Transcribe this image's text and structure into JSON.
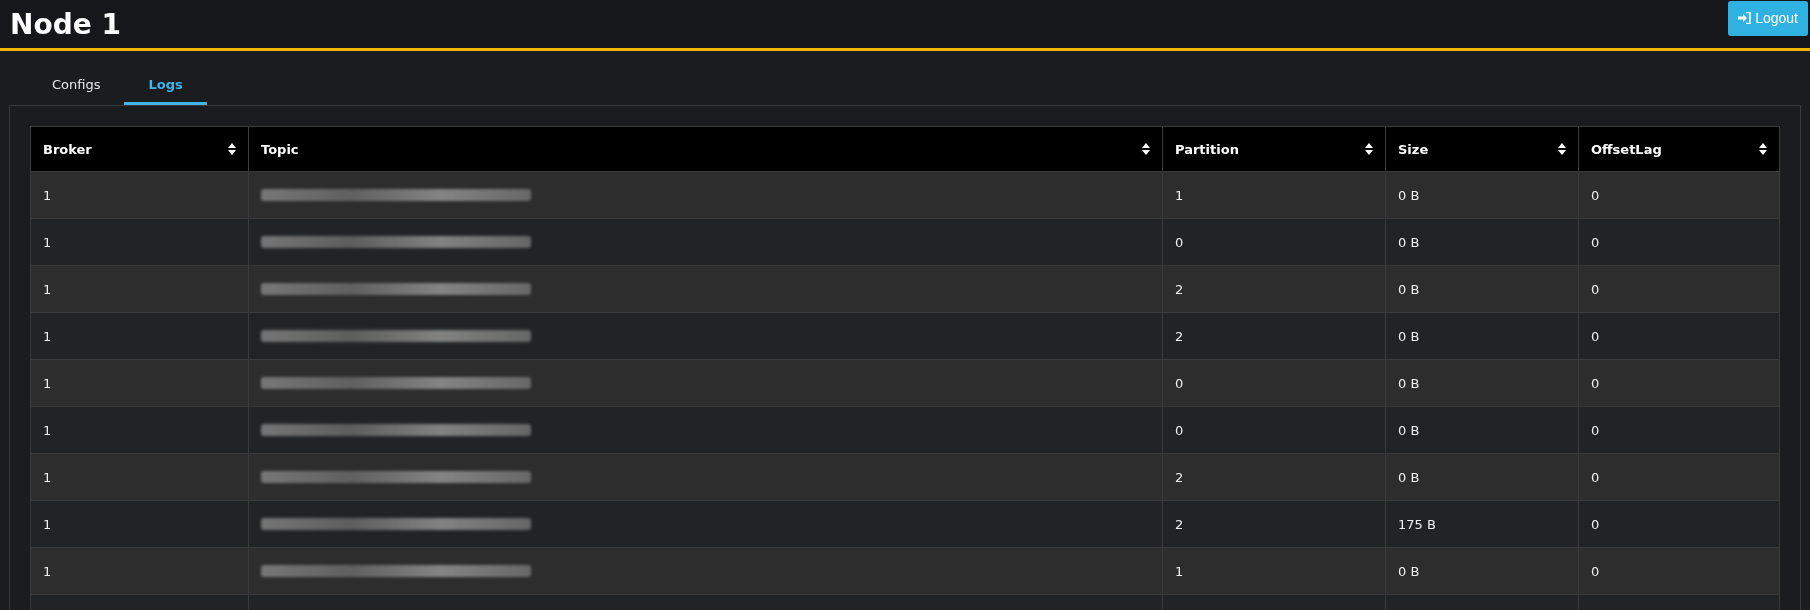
{
  "header": {
    "title": "Node 1",
    "logout": "Logout"
  },
  "tabs": [
    {
      "label": "Configs",
      "selected": false
    },
    {
      "label": "Logs",
      "selected": true
    }
  ],
  "table": {
    "columns": [
      "Broker",
      "Topic",
      "Partition",
      "Size",
      "OffsetLag"
    ],
    "rows": [
      {
        "broker": "1",
        "topic": {
          "kind": "redacted"
        },
        "partition": "1",
        "size": "0 B",
        "offset_lag": "0"
      },
      {
        "broker": "1",
        "topic": {
          "kind": "redacted"
        },
        "partition": "0",
        "size": "0 B",
        "offset_lag": "0"
      },
      {
        "broker": "1",
        "topic": {
          "kind": "redacted"
        },
        "partition": "2",
        "size": "0 B",
        "offset_lag": "0"
      },
      {
        "broker": "1",
        "topic": {
          "kind": "redacted"
        },
        "partition": "2",
        "size": "0 B",
        "offset_lag": "0"
      },
      {
        "broker": "1",
        "topic": {
          "kind": "redacted"
        },
        "partition": "0",
        "size": "0 B",
        "offset_lag": "0"
      },
      {
        "broker": "1",
        "topic": {
          "kind": "redacted"
        },
        "partition": "0",
        "size": "0 B",
        "offset_lag": "0"
      },
      {
        "broker": "1",
        "topic": {
          "kind": "redacted"
        },
        "partition": "2",
        "size": "0 B",
        "offset_lag": "0"
      },
      {
        "broker": "1",
        "topic": {
          "kind": "redacted"
        },
        "partition": "2",
        "size": "175 B",
        "offset_lag": "0"
      },
      {
        "broker": "1",
        "topic": {
          "kind": "redacted"
        },
        "partition": "1",
        "size": "0 B",
        "offset_lag": "0"
      }
    ]
  }
}
